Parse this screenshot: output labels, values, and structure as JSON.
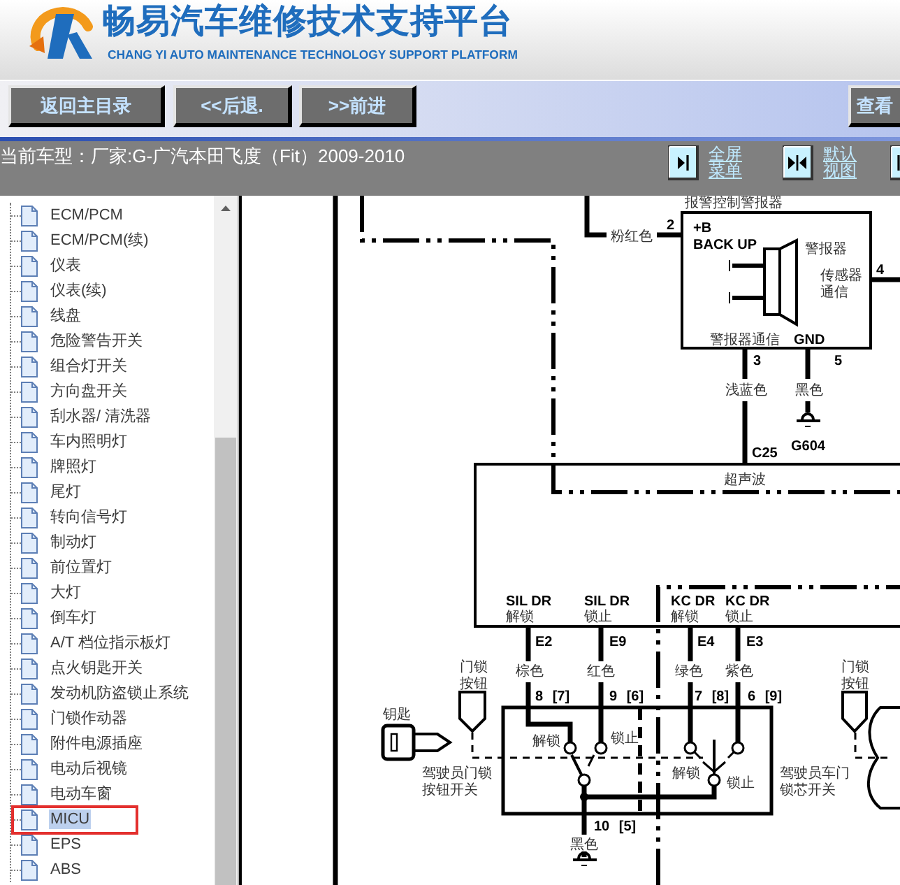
{
  "header": {
    "title": "畅易汽车维修技术支持平台",
    "subtitle": "CHANG YI AUTO MAINTENANCE TECHNOLOGY SUPPORT PLATFORM"
  },
  "toolbar": {
    "buttons": [
      {
        "label": "返回主目录"
      },
      {
        "label": "<<后退."
      },
      {
        "label": ">>前进"
      },
      {
        "label": "查看"
      }
    ]
  },
  "info_bar": {
    "label": "当前车型：",
    "value": "厂家:G-广汽本田飞度（Fit）2009-2010",
    "view_buttons": [
      {
        "kind": "fullscreen",
        "label": "全屏菜单"
      },
      {
        "kind": "default_view",
        "label": "默认视图"
      },
      {
        "kind": "partial"
      }
    ]
  },
  "sidebar": {
    "items": [
      {
        "label": "ECM/PCM",
        "selected": false
      },
      {
        "label": "ECM/PCM(续)",
        "selected": false
      },
      {
        "label": "仪表",
        "selected": false
      },
      {
        "label": "仪表(续)",
        "selected": false
      },
      {
        "label": "线盘",
        "selected": false
      },
      {
        "label": "危险警告开关",
        "selected": false
      },
      {
        "label": "组合灯开关",
        "selected": false
      },
      {
        "label": "方向盘开关",
        "selected": false
      },
      {
        "label": "刮水器/ 清洗器",
        "selected": false
      },
      {
        "label": "车内照明灯",
        "selected": false
      },
      {
        "label": "牌照灯",
        "selected": false
      },
      {
        "label": "尾灯",
        "selected": false
      },
      {
        "label": "转向信号灯",
        "selected": false
      },
      {
        "label": "制动灯",
        "selected": false
      },
      {
        "label": "前位置灯",
        "selected": false
      },
      {
        "label": "大灯",
        "selected": false
      },
      {
        "label": "倒车灯",
        "selected": false
      },
      {
        "label": "A/T 档位指示板灯",
        "selected": false
      },
      {
        "label": "点火钥匙开关",
        "selected": false
      },
      {
        "label": "发动机防盗锁止系统",
        "selected": false
      },
      {
        "label": "门锁作动器",
        "selected": false
      },
      {
        "label": "附件电源插座",
        "selected": false
      },
      {
        "label": "电动后视镜",
        "selected": false
      },
      {
        "label": "电动车窗",
        "selected": false
      },
      {
        "label": "MICU",
        "selected": true
      },
      {
        "label": "EPS",
        "selected": false
      },
      {
        "label": "ABS",
        "selected": false
      }
    ]
  },
  "diagram": {
    "labels": [
      {
        "kind": "component",
        "text": "报警控制警报器"
      },
      {
        "kind": "wire",
        "text": "粉红色"
      },
      {
        "kind": "pin",
        "text": "2"
      },
      {
        "kind": "terminal",
        "lines": [
          "+B",
          "BACK UP"
        ]
      },
      {
        "kind": "component",
        "text": "警报器"
      },
      {
        "kind": "signal",
        "lines": [
          "传感器",
          "通信"
        ]
      },
      {
        "kind": "pin",
        "text": "4"
      },
      {
        "kind": "signal",
        "text": "警报器通信"
      },
      {
        "kind": "terminal",
        "text": "GND"
      },
      {
        "kind": "pin",
        "text": "3"
      },
      {
        "kind": "pin",
        "text": "5"
      },
      {
        "kind": "wire",
        "text": "浅蓝色"
      },
      {
        "kind": "wire",
        "text": "黑色"
      },
      {
        "kind": "ground",
        "text": "G604"
      },
      {
        "kind": "connector",
        "text": "C25"
      },
      {
        "kind": "signal",
        "text": "超声波"
      },
      {
        "kind": "terminal",
        "text": "SIL DR"
      },
      {
        "kind": "signal",
        "text": "解锁"
      },
      {
        "kind": "terminal",
        "text": "SIL DR"
      },
      {
        "kind": "signal",
        "text": "锁止"
      },
      {
        "kind": "terminal",
        "text": "KC DR"
      },
      {
        "kind": "signal",
        "text": "解锁"
      },
      {
        "kind": "terminal",
        "text": "KC DR"
      },
      {
        "kind": "signal",
        "text": "锁止"
      },
      {
        "kind": "pin",
        "text": "E2"
      },
      {
        "kind": "pin",
        "text": "E9"
      },
      {
        "kind": "pin",
        "text": "E4"
      },
      {
        "kind": "pin",
        "text": "E3"
      },
      {
        "kind": "component",
        "lines": [
          "门锁",
          "按钮"
        ]
      },
      {
        "kind": "wire",
        "text": "棕色"
      },
      {
        "kind": "wire",
        "text": "红色"
      },
      {
        "kind": "wire",
        "text": "绿色"
      },
      {
        "kind": "wire",
        "text": "紫色"
      },
      {
        "kind": "pin",
        "text": "8 [7]"
      },
      {
        "kind": "pin",
        "text": "9 [6]"
      },
      {
        "kind": "pin",
        "text": "7 [8]"
      },
      {
        "kind": "pin",
        "text": "6 [9]"
      },
      {
        "kind": "component",
        "text": "钥匙"
      },
      {
        "kind": "signal",
        "text": "解锁"
      },
      {
        "kind": "signal",
        "text": "锁止"
      },
      {
        "kind": "component",
        "lines": [
          "驾驶员门锁",
          "按钮开关"
        ]
      },
      {
        "kind": "signal",
        "text": "解锁"
      },
      {
        "kind": "signal",
        "text": "锁止"
      },
      {
        "kind": "component",
        "lines": [
          "驾驶员车门",
          "锁芯开关"
        ]
      },
      {
        "kind": "pin",
        "text": "10 [5]"
      },
      {
        "kind": "wire",
        "text": "黑色"
      },
      {
        "kind": "component",
        "lines": [
          "门锁",
          "按钮"
        ]
      }
    ]
  }
}
